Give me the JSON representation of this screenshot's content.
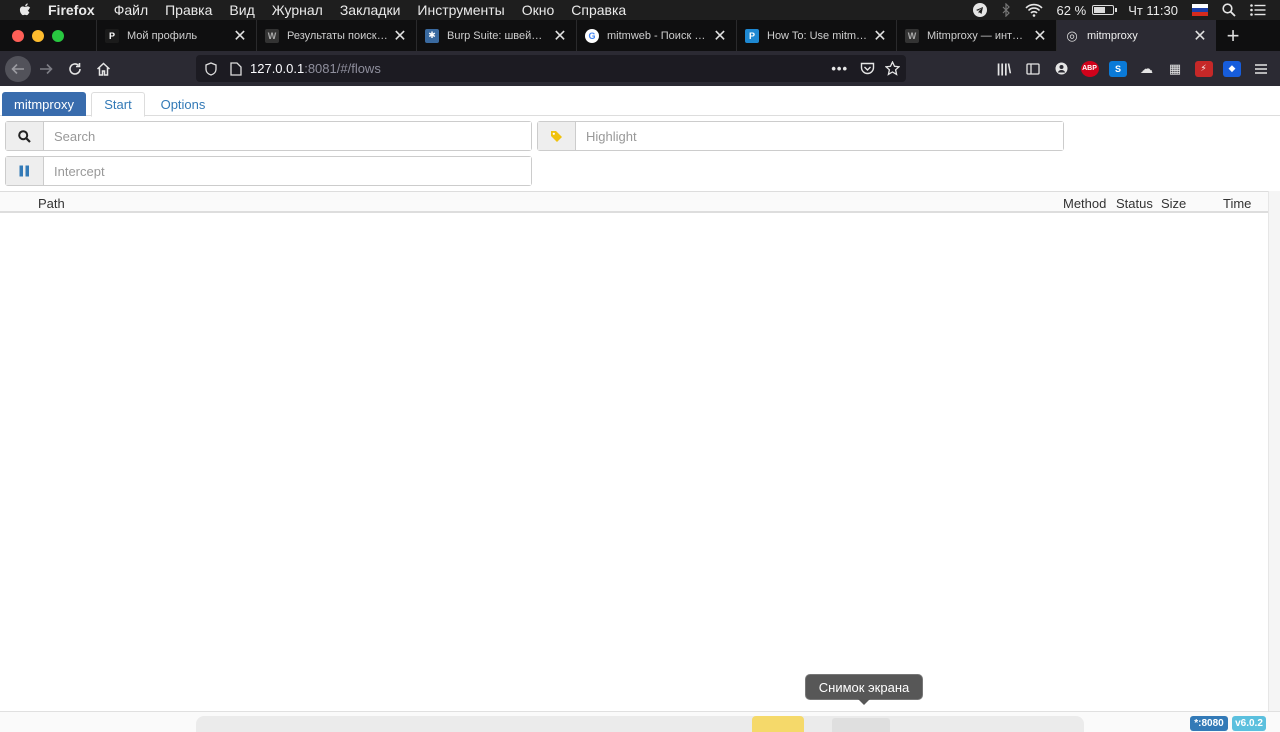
{
  "menubar": {
    "app_name": "Firefox",
    "items": [
      "Файл",
      "Правка",
      "Вид",
      "Журнал",
      "Закладки",
      "Инструменты",
      "Окно",
      "Справка"
    ],
    "battery_percent": "62 %",
    "battery_level": 0.62,
    "clock": "Чт 11:30"
  },
  "tabs": [
    {
      "title": "Мой профиль",
      "favicon": "pikabu-favicon",
      "favicon_text": "P",
      "favicon_color": "#1b1b1b"
    },
    {
      "title": "Результаты поиска по",
      "favicon": "w-favicon",
      "favicon_text": "W",
      "favicon_color": "#333333"
    },
    {
      "title": "Burp Suite: швейцарск",
      "favicon": "burp-favicon",
      "favicon_text": "✱",
      "favicon_color": "#3a6aa0"
    },
    {
      "title": "mitmweb - Поиск в Go",
      "favicon": "google-favicon",
      "favicon_text": "G",
      "favicon_color": "#ffffff"
    },
    {
      "title": "How To: Use mitmprox",
      "favicon": "p-favicon",
      "favicon_text": "P",
      "favicon_color": "#1e88d2"
    },
    {
      "title": "Mitmproxy — интеракт",
      "favicon": "w-favicon",
      "favicon_text": "W",
      "favicon_color": "#333333"
    },
    {
      "title": "mitmproxy",
      "favicon": "mitmproxy-favicon",
      "favicon_text": "◎",
      "favicon_color": "#2b2a33",
      "active": true
    }
  ],
  "navbar": {
    "url_host": "127.0.0.1",
    "url_rest": ":8081/#/flows"
  },
  "app": {
    "brand": "mitmproxy",
    "tabs": [
      "Start",
      "Options"
    ],
    "search_placeholder": "Search",
    "highlight_placeholder": "Highlight",
    "intercept_placeholder": "Intercept",
    "columns": {
      "path": "Path",
      "method": "Method",
      "status": "Status",
      "size": "Size",
      "time": "Time"
    }
  },
  "footer": {
    "mode": "*:8080",
    "version": "v6.0.2"
  },
  "tooltip": "Снимок экрана",
  "colors": {
    "brand": "#396cad",
    "link": "#337ab7",
    "highlight_icon": "#f0c20c",
    "intercept_icon": "#337ab7"
  }
}
